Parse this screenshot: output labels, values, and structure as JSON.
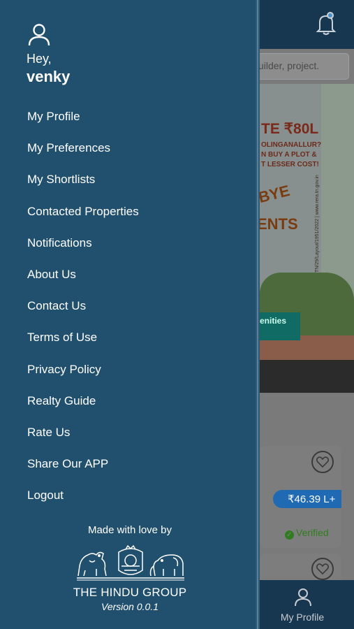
{
  "drawer": {
    "greeting": "Hey,",
    "username": "venky",
    "menu": [
      "My Profile",
      "My Preferences",
      "My Shortlists",
      "Contacted Properties",
      "Notifications",
      "About Us",
      "Contact Us",
      "Terms of Use",
      "Privacy Policy",
      "Realty Guide",
      "Rate Us",
      "Share Our APP",
      "Logout"
    ],
    "footer": {
      "made_with": "Made with love by",
      "brand": "THE HINDU GROUP",
      "version": "Version 0.0.1"
    }
  },
  "background": {
    "search_placeholder": "uilder, project.",
    "banner": {
      "price": "TE ₹80L",
      "line1": "OLINGANALLUR?",
      "line2": "N BUY A PLOT &",
      "line3": "T LESSER COST!",
      "rera": "TN/29/Layout/1951/2022 | www.rera.tn.gov.in",
      "tag": "enities"
    },
    "card": {
      "price": "₹46.39 L+",
      "verified": "Verified"
    },
    "bottom_nav": {
      "label": "My Profile"
    }
  },
  "colors": {
    "drawer_bg": "#21506f",
    "header_bg": "#17364f",
    "price_badge": "#1f6ab3",
    "verified": "#2f7d1f"
  },
  "icons": [
    "user-icon",
    "bell-icon",
    "heart-icon",
    "check-circle-icon",
    "hindu-group-logo"
  ]
}
